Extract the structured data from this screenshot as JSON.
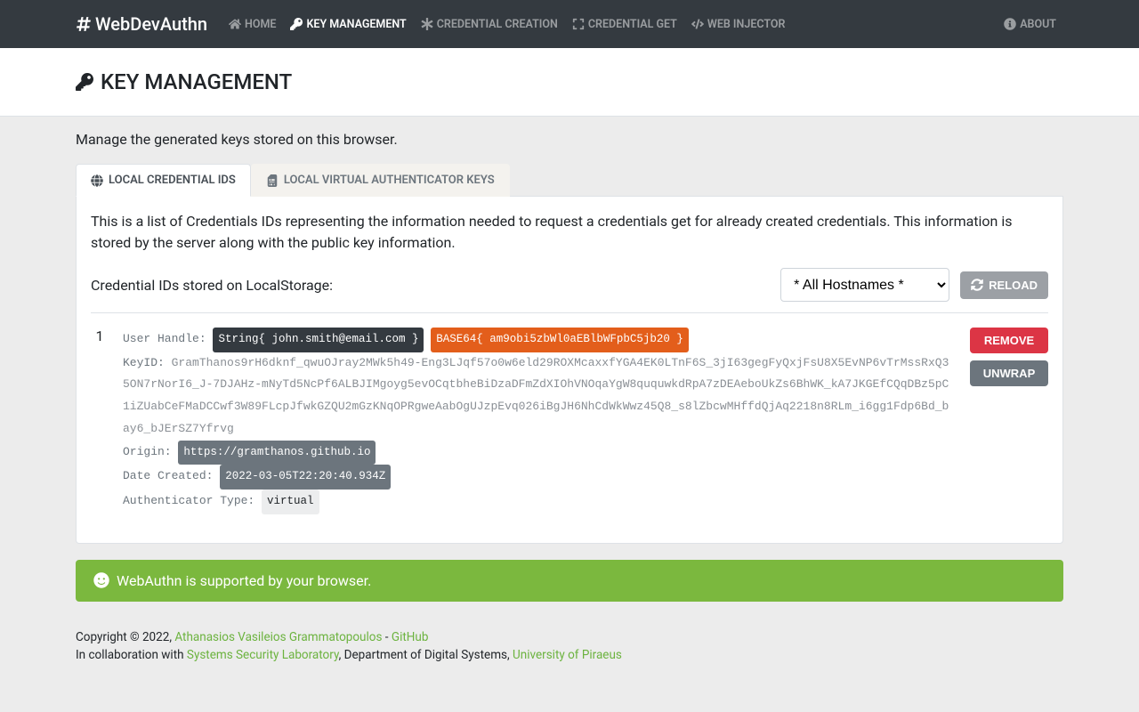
{
  "brand": "WebDevAuthn",
  "nav": {
    "home": "Home",
    "key_management": "Key Management",
    "credential_creation": "Credential Creation",
    "credential_get": "Credential Get",
    "web_injector": "Web Injector",
    "about": "About"
  },
  "page_title": "KEY MANAGEMENT",
  "intro": "Manage the generated keys stored on this browser.",
  "tabs": {
    "local_ids": "Local Credential IDs",
    "virtual_keys": "Local Virtual Authenticator Keys"
  },
  "local_ids": {
    "desc": "This is a list of Credentials IDs representing the information needed to request a credentials get for already created credentials. This information is stored by the server along with the public key information.",
    "listing_label": "Credential IDs stored on LocalStorage:",
    "hostnames_selected": "* All Hostnames *",
    "reload": "Reload"
  },
  "credential": {
    "num": "1",
    "labels": {
      "user_handle": "User Handle:",
      "key_id": "KeyID:",
      "origin": "Origin:",
      "date_created": "Date Created:",
      "auth_type": "Authenticator Type:"
    },
    "user_handle_string": "String{ john.smith@email.com }",
    "user_handle_base64": "BASE64{ am9obi5zbWl0aEBlbWFpbC5jb20 }",
    "key_id": "GramThanos9rH6dknf_qwuOJray2MWk5h49-Eng3LJqf57o0w6eld29ROXMcaxxfYGA4EK0LTnF6S_3jI63gegFyQxjFsU8X5EvNP6vTrMssRxQ35ON7rNorI6_J-7DJAHz-mNyTd5NcPf6ALBJIMgoyg5evOCqtbheBiDzaDFmZdXIOhVNOqaYgW8ququwkdRpA7zDEAeboUkZs6BhWK_kA7JKGEfCQqDBz5pC1iZUabCeFMaDCCwf3W89FLcpJfwkGZQU2mGzKNqOPRgweAabOgUJzpEvq026iBgJH6NhCdWkWwz45Q8_s8lZbcwMHffdQjAq2218n8RLm_i6gg1Fdp6Bd_bay6_bJErSZ7Yfrvg",
    "origin": "https://gramthanos.github.io",
    "date_created": "2022-03-05T22:20:40.934Z",
    "auth_type": "virtual",
    "actions": {
      "remove": "Remove",
      "unwrap": "Unwrap"
    }
  },
  "alert": "WebAuthn is supported by your browser.",
  "footer": {
    "copyright_prefix": "Copyright © 2022, ",
    "author": "Athanasios Vasileios Grammatopoulos",
    "dash": " - ",
    "github": "GitHub",
    "collab_prefix": "In collaboration with ",
    "ssl": "Systems Security Laboratory",
    "dept": ", Department of Digital Systems, ",
    "univ": "University of Piraeus"
  }
}
